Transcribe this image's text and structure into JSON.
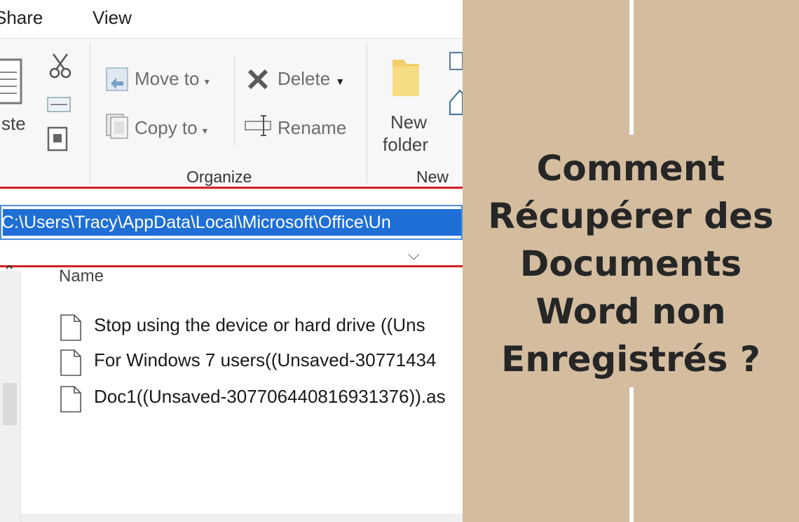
{
  "menu": {
    "share": "hare",
    "view": "View"
  },
  "ribbon": {
    "paste_label": "ste",
    "move_to": "Move to",
    "copy_to": "Copy to",
    "delete": "Delete",
    "rename": "Rename",
    "new_folder_line1": "New",
    "new_folder_line2": "folder",
    "organize_group": "Organize",
    "new_group": "New"
  },
  "address_bar": {
    "path": "C:\\Users\\Tracy\\AppData\\Local\\Microsoft\\Office\\Un"
  },
  "file_list": {
    "column_name": "Name",
    "files": [
      {
        "name": "Stop using the device or hard drive ((Uns"
      },
      {
        "name": "For Windows 7 users((Unsaved-30771434"
      },
      {
        "name": "Doc1((Unsaved-307706440816931376)).as"
      }
    ]
  },
  "title": {
    "line1": "Comment",
    "line2": "Récupérer des",
    "line3": "Documents",
    "line4": "Word non",
    "line5": "Enregistrés ?"
  },
  "colors": {
    "panel_bg": "#d4bc9f",
    "title_text": "#262626",
    "highlight_red": "#d42020",
    "address_selection": "#1f6fd6"
  }
}
